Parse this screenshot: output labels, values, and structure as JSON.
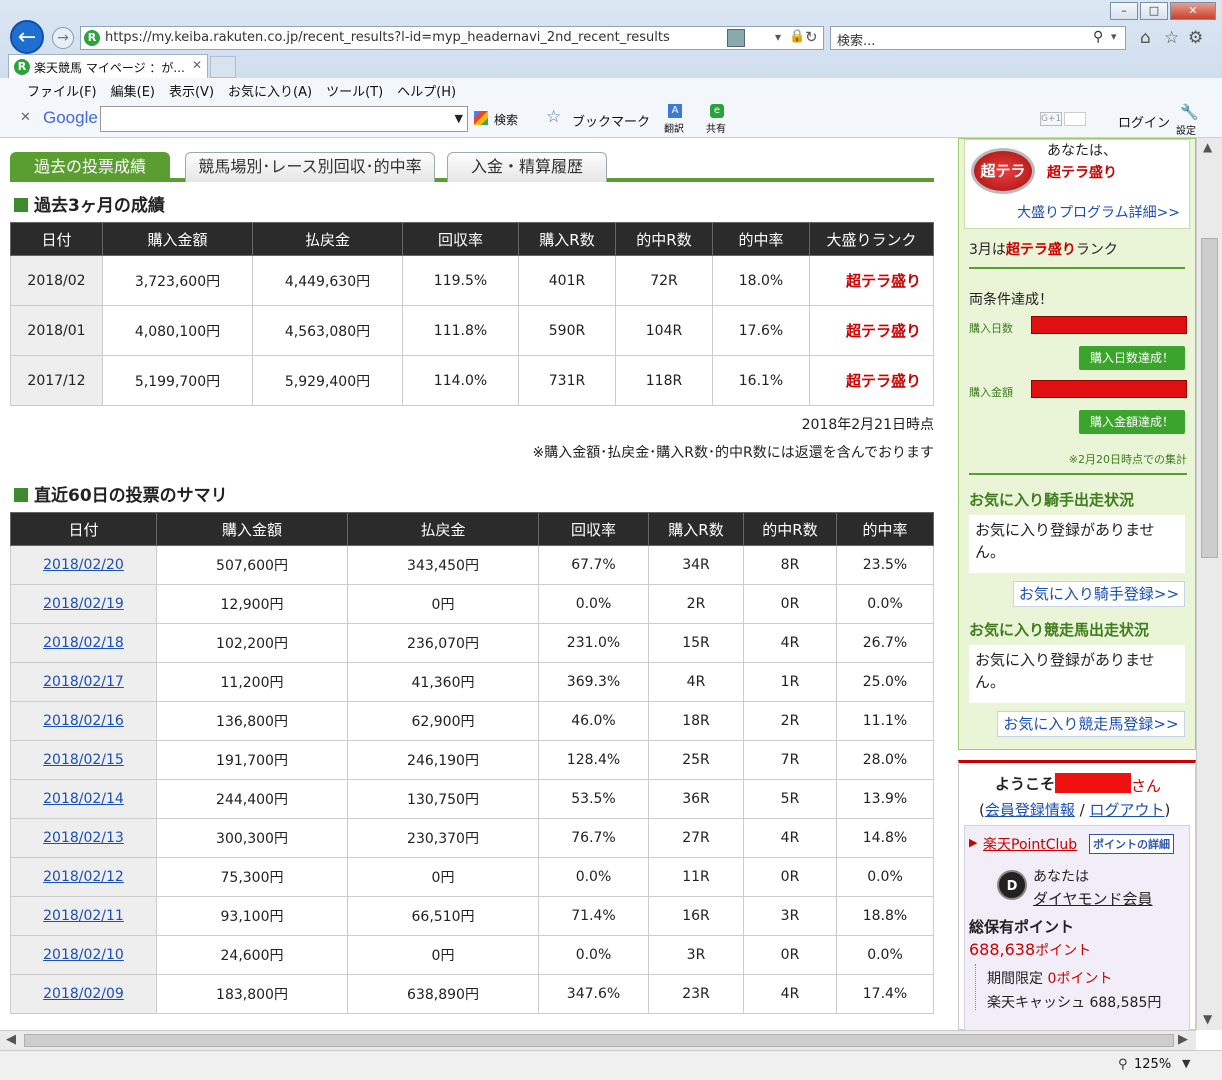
{
  "browser": {
    "url": "https://my.keiba.rakuten.co.jp/recent_results?l-id=myp_headernavi_2nd_recent_results",
    "search_placeholder": "検索...",
    "tab_title": "楽天競馬 マイページ ：が...",
    "menu": [
      "ファイル(F)",
      "編集(E)",
      "表示(V)",
      "お気に入り(A)",
      "ツール(T)",
      "ヘルプ(H)"
    ],
    "google_label": "Google",
    "search_btn": "検索",
    "bookmark_btn": "ブックマーク",
    "translate_btn": "翻訳",
    "share_btn": "共有",
    "login_btn": "ログイン",
    "settings_btn": "設定",
    "zoom": "125%",
    "gplus": "G+1"
  },
  "tabs": [
    "過去の投票成績",
    "競馬場別･レース別回収･的中率",
    "入金・精算履歴"
  ],
  "past3": {
    "title": "過去3ヶ月の成績",
    "headers": [
      "日付",
      "購入金額",
      "払戻金",
      "回収率",
      "購入R数",
      "的中R数",
      "的中率",
      "大盛りランク"
    ],
    "rows": [
      [
        "2018/02",
        "3,723,600円",
        "4,449,630円",
        "119.5%",
        "401R",
        "72R",
        "18.0%",
        "超テラ盛り"
      ],
      [
        "2018/01",
        "4,080,100円",
        "4,563,080円",
        "111.8%",
        "590R",
        "104R",
        "17.6%",
        "超テラ盛り"
      ],
      [
        "2017/12",
        "5,199,700円",
        "5,929,400円",
        "114.0%",
        "731R",
        "118R",
        "16.1%",
        "超テラ盛り"
      ]
    ],
    "as_of": "2018年2月21日時点",
    "note": "※購入金額･払戻金･購入R数･的中R数には返還を含んでおります"
  },
  "recent60": {
    "title": "直近60日の投票のサマリ",
    "headers": [
      "日付",
      "購入金額",
      "払戻金",
      "回収率",
      "購入R数",
      "的中R数",
      "的中率"
    ],
    "rows": [
      [
        "2018/02/20",
        "507,600円",
        "343,450円",
        "67.7%",
        "34R",
        "8R",
        "23.5%"
      ],
      [
        "2018/02/19",
        "12,900円",
        "0円",
        "0.0%",
        "2R",
        "0R",
        "0.0%"
      ],
      [
        "2018/02/18",
        "102,200円",
        "236,070円",
        "231.0%",
        "15R",
        "4R",
        "26.7%"
      ],
      [
        "2018/02/17",
        "11,200円",
        "41,360円",
        "369.3%",
        "4R",
        "1R",
        "25.0%"
      ],
      [
        "2018/02/16",
        "136,800円",
        "62,900円",
        "46.0%",
        "18R",
        "2R",
        "11.1%"
      ],
      [
        "2018/02/15",
        "191,700円",
        "246,190円",
        "128.4%",
        "25R",
        "7R",
        "28.0%"
      ],
      [
        "2018/02/14",
        "244,400円",
        "130,750円",
        "53.5%",
        "36R",
        "5R",
        "13.9%"
      ],
      [
        "2018/02/13",
        "300,300円",
        "230,370円",
        "76.7%",
        "27R",
        "4R",
        "14.8%"
      ],
      [
        "2018/02/12",
        "75,300円",
        "0円",
        "0.0%",
        "11R",
        "0R",
        "0.0%"
      ],
      [
        "2018/02/11",
        "93,100円",
        "66,510円",
        "71.4%",
        "16R",
        "3R",
        "18.8%"
      ],
      [
        "2018/02/10",
        "24,600円",
        "0円",
        "0.0%",
        "3R",
        "0R",
        "0.0%"
      ],
      [
        "2018/02/09",
        "183,800円",
        "638,890円",
        "347.6%",
        "23R",
        "4R",
        "17.4%"
      ]
    ]
  },
  "sidebar": {
    "badge": "超テラ",
    "rank_prefix": "あなたは、",
    "rank_name": "超テラ盛り",
    "program_link": "大盛りプログラム詳細>>",
    "march_pre": "3月は",
    "march_rank": "超テラ盛り",
    "march_post": "ランク",
    "achieved": "両条件達成！",
    "days_label": "購入日数",
    "days_btn": "購入日数達成！",
    "amount_label": "購入金額",
    "amount_btn": "購入金額達成！",
    "tally": "※2月20日時点での集計",
    "jockey_title": "お気に入り騎手出走状況",
    "jockey_empty": "お気に入り登録がありません。",
    "jockey_btn": "お気に入り騎手登録>>",
    "horse_title": "お気に入り競走馬出走状況",
    "horse_empty": "お気に入り登録がありません。",
    "horse_btn": "お気に入り競走馬登録>>",
    "welcome": "ようこそ",
    "san": "さん",
    "member_info": "会員登録情報",
    "logout": "ログアウト",
    "point_club": "楽天PointClub",
    "point_detail": "ポイントの詳細",
    "you_are": "あなたは",
    "member_rank": "ダイヤモンド会員",
    "total_label": "総保有ポイント",
    "total_points": "688,638",
    "point_unit": "ポイント",
    "limited_label": "期間限定",
    "limited_value": "0ポイント",
    "cash_label": "楽天キャッシュ",
    "cash_value": "688,585円"
  },
  "colors": {
    "accent_green": "#5a9e32",
    "rank_red": "#cc0000",
    "link_blue": "#1a4fb3"
  }
}
